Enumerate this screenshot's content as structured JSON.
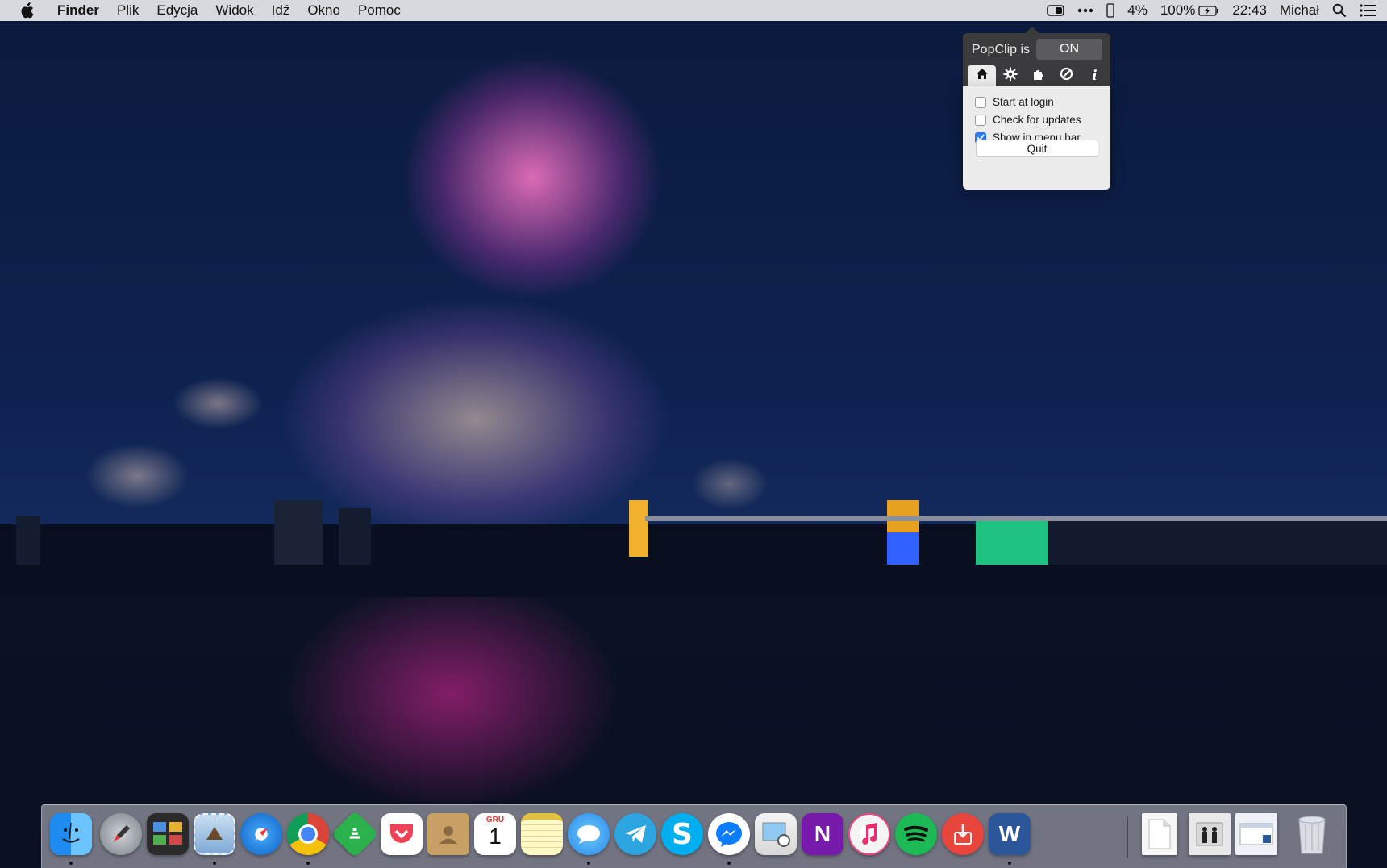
{
  "menubar": {
    "app_name": "Finder",
    "menus": [
      "Plik",
      "Edycja",
      "Widok",
      "Idź",
      "Okno",
      "Pomoc"
    ],
    "status": {
      "phone_battery": "4%",
      "battery": "100%",
      "time": "22:43",
      "user": "Michał"
    },
    "icons": [
      "apple-icon",
      "popclip-icon",
      "more-icon",
      "phone-icon",
      "battery-icon",
      "spotlight-icon",
      "notification-center-icon"
    ]
  },
  "popclip": {
    "title": "PopClip is",
    "toggle": "ON",
    "tabs": [
      "home-icon",
      "gear-icon",
      "puzzle-icon",
      "blocked-icon",
      "info-icon"
    ],
    "options": [
      {
        "label": "Start at login",
        "checked": false
      },
      {
        "label": "Check for updates",
        "checked": false
      },
      {
        "label": "Show in menu bar",
        "checked": true
      }
    ],
    "quit_label": "Quit"
  },
  "dock": {
    "calendar_month": "GRU",
    "calendar_day": "1",
    "apps": [
      "finder",
      "launchpad",
      "mission-control",
      "mail",
      "safari",
      "chrome",
      "feedly",
      "pocket",
      "contacts",
      "calendar",
      "notes",
      "messages",
      "telegram",
      "skype",
      "messenger",
      "preview",
      "onenote",
      "itunes",
      "spotify",
      "downloader",
      "word"
    ],
    "stack_items": [
      "document-stack",
      "photos-stack",
      "window-stack",
      "trash"
    ]
  }
}
